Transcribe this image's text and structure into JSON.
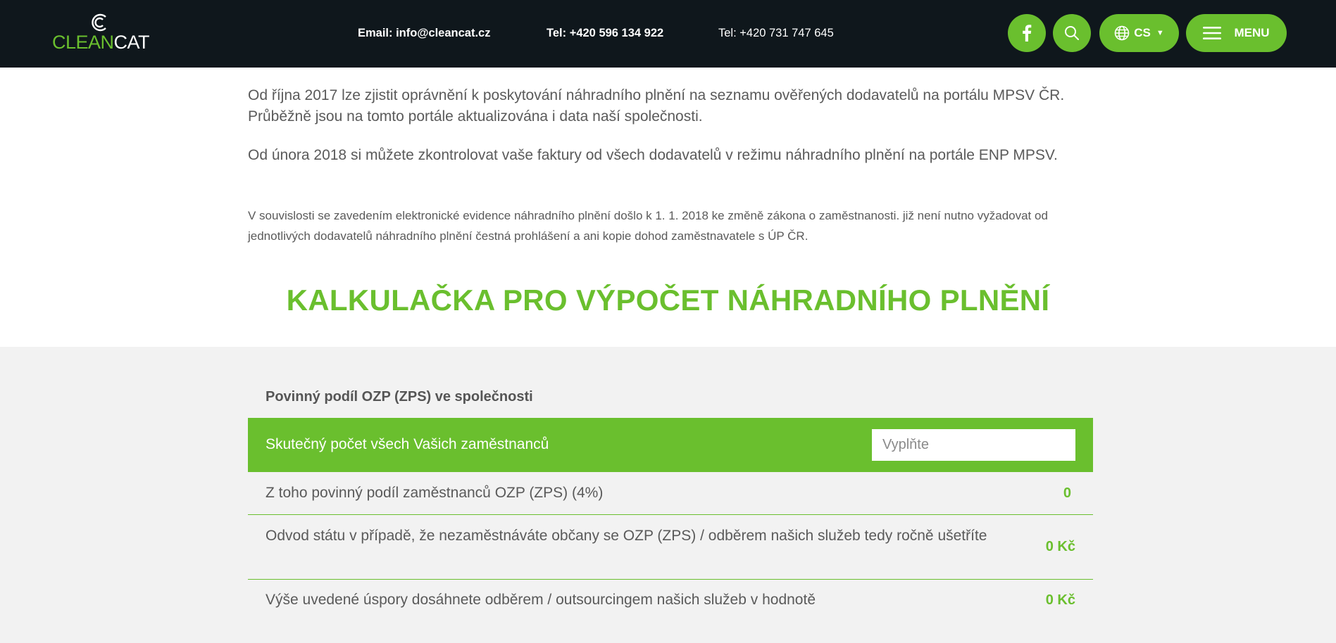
{
  "header": {
    "logo": {
      "part1": "CLEAN",
      "part2": "CAT"
    },
    "email": "Email: info@cleancat.cz",
    "phone1": "Tel: +420 596 134 922",
    "phone2": "Tel: +420 731 747 645",
    "language": "CS",
    "menu_label": "MENU"
  },
  "content": {
    "para1": "Od října 2017 lze zjistit oprávnění k poskytování náhradního plnění na seznamu ověřených dodavatelů na portálu MPSV ČR. Průběžně jsou na tomto portále aktualizována i data naší společnosti.",
    "para2": "Od února 2018 si můžete zkontrolovat vaše faktury od všech dodavatelů v režimu náhradního plnění na portále ENP MPSV.",
    "note": "V souvislosti se zavedením elektronické evidence náhradního plnění došlo k 1. 1. 2018 ke změně zákona o zaměstnanosti. již není nutno vyžadovat od jednotlivých dodavatelů náhradního plnění čestná prohlášení a ani kopie dohod zaměstnavatele s ÚP ČR.",
    "heading": "KALKULAČKA PRO VÝPOČET NÁHRADNÍHO PLNĚNÍ"
  },
  "calculator": {
    "title": "Povinný podíl OZP (ZPS) ve společnosti",
    "employees_label": "Skutečný počet všech Vašich zaměstnanců",
    "employees_placeholder": "Vyplňte",
    "rows": [
      {
        "label": "Z toho povinný podíl zaměstnanců OZP (ZPS) (4%)",
        "value": "0"
      },
      {
        "label": "Odvod státu v případě, že nezaměstnáváte občany se OZP (ZPS) / odběrem našich služeb tedy ročně ušetříte",
        "value": "0 Kč"
      },
      {
        "label": "Výše uvedené úspory dosáhnete odběrem / outsourcingem našich služeb v hodnotě",
        "value": "0 Kč"
      }
    ]
  },
  "colors": {
    "brand_green": "#6abf2e",
    "header_bg": "#0f171c",
    "calc_bg": "#f2f2f2"
  },
  "icons": [
    "facebook-icon",
    "search-icon",
    "globe-icon",
    "hamburger-icon",
    "logo-c-icon"
  ]
}
